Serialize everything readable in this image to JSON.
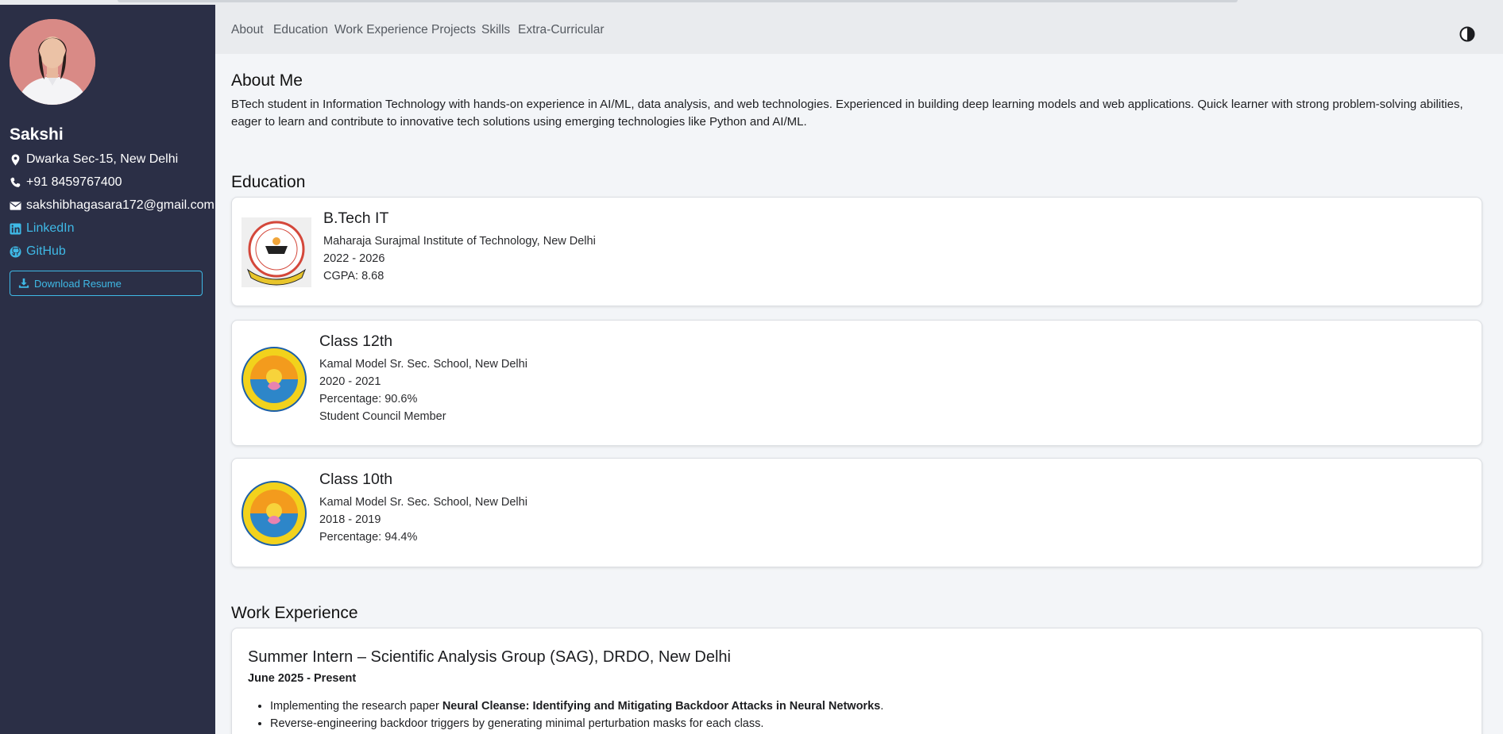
{
  "profile": {
    "name": "Sakshi",
    "location": "Dwarka Sec-15, New Delhi",
    "phone": "+91 8459767400",
    "email": "sakshibhagasara172@gmail.com",
    "linkedin_label": "LinkedIn",
    "github_label": "GitHub",
    "resume_button": "Download Resume"
  },
  "nav": {
    "items": [
      "About",
      "Education",
      "Work Experience",
      "Projects",
      "Skills",
      "Extra-Curricular"
    ],
    "theme_icon": "contrast-icon"
  },
  "about": {
    "title": "About Me",
    "text": "BTech student in Information Technology with hands-on experience in AI/ML, data analysis, and web technologies. Experienced in building deep learning models and web applications. Quick learner with strong problem-solving abilities, eager to learn and contribute to innovative tech solutions using emerging technologies like Python and AI/ML."
  },
  "education": {
    "title": "Education",
    "entries": [
      {
        "degree": "B.Tech IT",
        "institution": "Maharaja Surajmal Institute of Technology, New Delhi",
        "years": "2022 - 2026",
        "score": "CGPA: 8.68"
      },
      {
        "degree": "Class 12th",
        "institution": "Kamal Model Sr. Sec. School, New Delhi",
        "years": "2020 - 2021",
        "score": "Percentage: 90.6%",
        "note": "Student Council Member"
      },
      {
        "degree": "Class 10th",
        "institution": "Kamal Model Sr. Sec. School, New Delhi",
        "years": "2018 - 2019",
        "score": "Percentage: 94.4%"
      }
    ]
  },
  "work": {
    "title": "Work Experience",
    "entries": [
      {
        "role": "Summer Intern – Scientific Analysis Group (SAG), DRDO, New Delhi",
        "dates": "June 2025 - Present",
        "bullets": [
          {
            "prefix": "Implementing the research paper ",
            "bold": "Neural Cleanse: Identifying and Mitigating Backdoor Attacks in Neural Networks",
            "suffix": "."
          },
          {
            "prefix": "Reverse-engineering backdoor triggers by generating minimal perturbation masks for each class.",
            "bold": "",
            "suffix": ""
          }
        ]
      }
    ]
  },
  "colors": {
    "sidebar_bg": "#2b2f46",
    "accent": "#3fb9e6",
    "navbar_bg": "#e9ebee",
    "page_bg": "#f3f5f8"
  }
}
